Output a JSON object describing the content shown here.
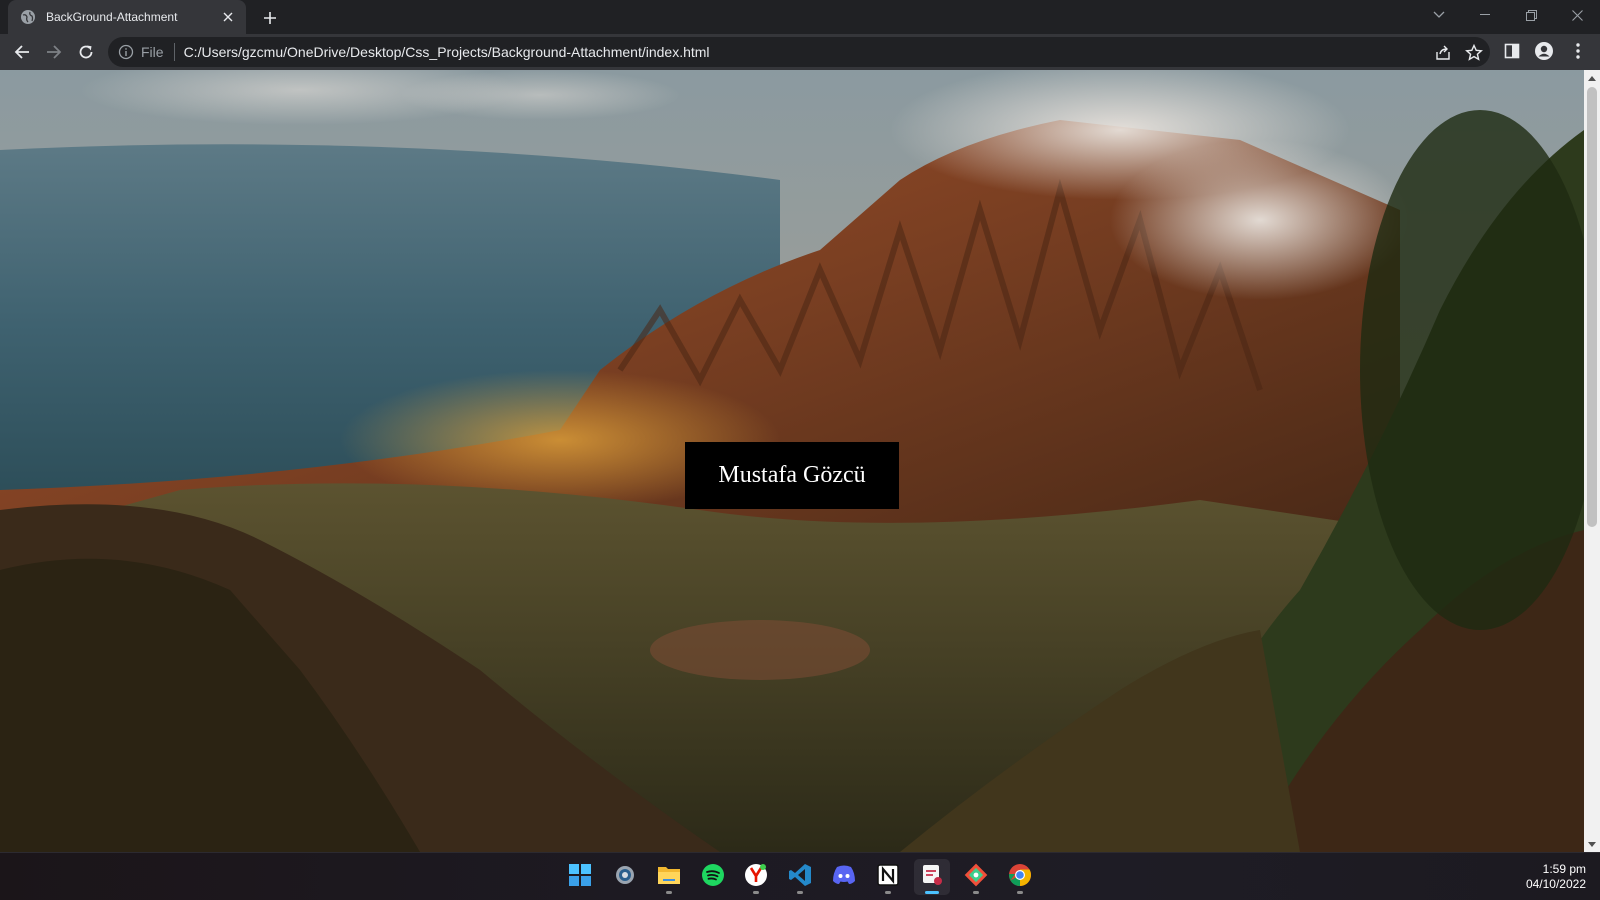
{
  "browser": {
    "tab": {
      "title": "BackGround-Attachment"
    },
    "address": {
      "scheme_label": "File",
      "url": "C:/Users/gzcmu/OneDrive/Desktop/Css_Projects/Background-Attachment/index.html"
    }
  },
  "page": {
    "name": "Mustafa Gözcü",
    "background": "mountain valley and ocean coastline photo"
  },
  "taskbar": {
    "apps": [
      {
        "icon": "windows-start-icon"
      },
      {
        "icon": "settings-icon"
      },
      {
        "icon": "file-explorer-icon"
      },
      {
        "icon": "spotify-icon"
      },
      {
        "icon": "yandex-browser-icon"
      },
      {
        "icon": "vscode-icon"
      },
      {
        "icon": "discord-icon"
      },
      {
        "icon": "notion-icon"
      },
      {
        "icon": "snipping-tool-icon"
      },
      {
        "icon": "git-icon"
      },
      {
        "icon": "chrome-icon"
      }
    ],
    "clock": {
      "time": "1:59 pm",
      "date": "04/10/2022"
    }
  },
  "colors": {
    "tab_active": "#35363a",
    "tab_strip": "#202124",
    "omnibox": "#202124",
    "name_box": "#000000",
    "taskbar_accent": "#4cc2ff"
  }
}
